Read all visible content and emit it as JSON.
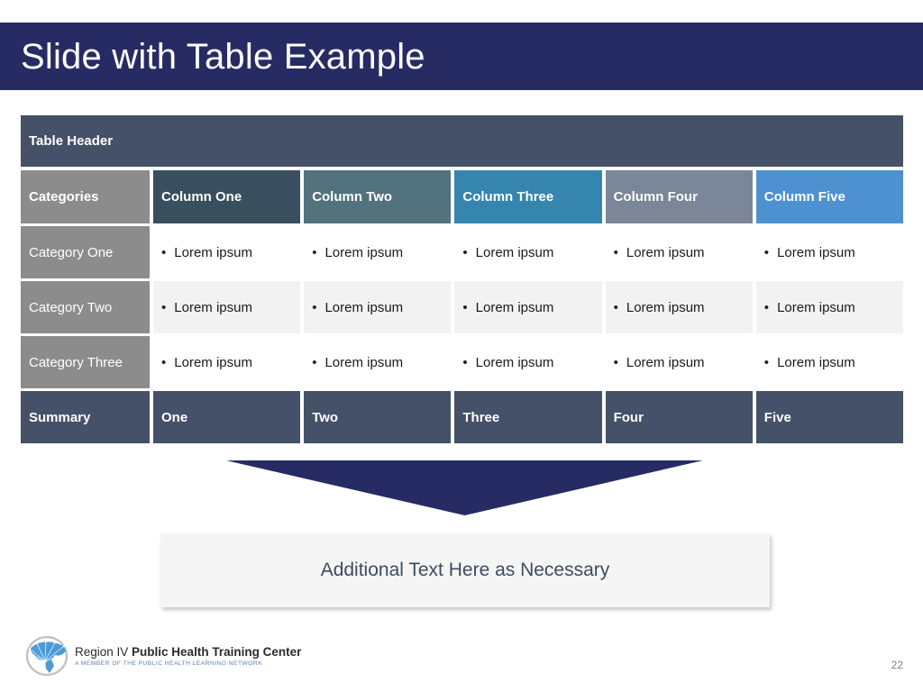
{
  "slide": {
    "title": "Slide with Table Example",
    "page_number": "22",
    "title_bg": "#262C63"
  },
  "table": {
    "header_label": "Table Header",
    "header_bg": "#445168",
    "columns": [
      {
        "label": "Categories",
        "bg": "#8C8C8C"
      },
      {
        "label": "Column One",
        "bg": "#3A4F5E"
      },
      {
        "label": "Column Two",
        "bg": "#52727E"
      },
      {
        "label": "Column Three",
        "bg": "#3585AF"
      },
      {
        "label": "Column Four",
        "bg": "#7B8699"
      },
      {
        "label": "Column Five",
        "bg": "#4E91D0"
      }
    ],
    "bullet_glyph": "•",
    "rows": [
      {
        "category": "Category One",
        "cells": [
          "Lorem ipsum",
          "Lorem ipsum",
          "Lorem ipsum",
          "Lorem ipsum",
          "Lorem ipsum"
        ]
      },
      {
        "category": "Category Two",
        "cells": [
          "Lorem ipsum",
          "Lorem ipsum",
          "Lorem ipsum",
          "Lorem ipsum",
          "Lorem ipsum"
        ]
      },
      {
        "category": "Category Three",
        "cells": [
          "Lorem ipsum",
          "Lorem ipsum",
          "Lorem ipsum",
          "Lorem ipsum",
          "Lorem ipsum"
        ]
      }
    ],
    "summary": {
      "label": "Summary",
      "cells": [
        "One",
        "Two",
        "Three",
        "Four",
        "Five"
      ]
    }
  },
  "arrow": {
    "color": "#262C63"
  },
  "callout": {
    "text": "Additional Text Here as Necessary",
    "bg": "#F5F5F5",
    "text_color": "#3F4A63"
  },
  "footer": {
    "logo_title_part1": "Region IV ",
    "logo_title_part2": "Public Health Training Center",
    "logo_subtitle": "A MEMBER OF THE PUBLIC HEALTH LEARNING NETWORK"
  }
}
